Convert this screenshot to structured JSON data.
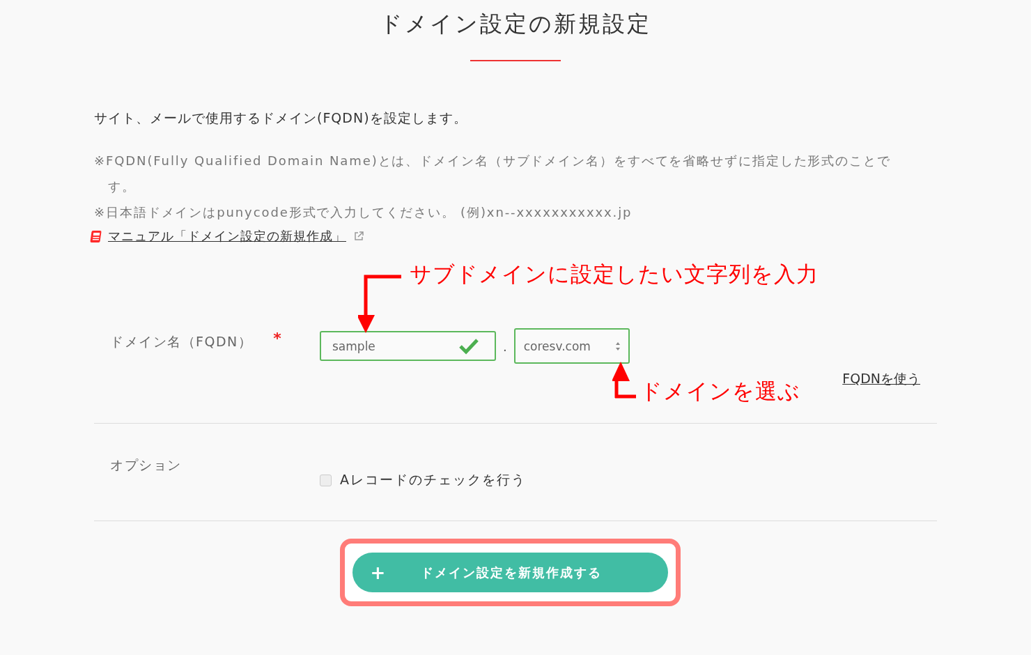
{
  "title": "ドメイン設定の新規設定",
  "description": "サイト、メールで使用するドメイン(FQDN)を設定します。",
  "notes": [
    "※FQDN(Fully Qualified Domain Name)とは、ドメイン名（サブドメイン名）をすべてを省略せずに指定した形式のことです。",
    "※日本語ドメインはpunycode形式で入力してください。 (例)xn--xxxxxxxxxxx.jp"
  ],
  "manual_link": "マニュアル「ドメイン設定の新規作成」",
  "form": {
    "rows": [
      {
        "kind": "domain",
        "label": "ドメイン名（FQDN）",
        "required": true,
        "required_mark": "*",
        "subdomain": {
          "value": "sample",
          "valid": true
        },
        "separator": ".",
        "domain_select": {
          "value": "coresv.com"
        },
        "link": "FQDNを使う"
      },
      {
        "kind": "options",
        "label": "オプション",
        "checkbox": {
          "label": "Aレコードのチェックを行う",
          "checked": false
        }
      }
    ]
  },
  "submit": {
    "icon": "+",
    "label": "ドメイン設定を新規作成する",
    "highlighted": true
  },
  "annotations": [
    {
      "kind": "down",
      "text": "サブドメインに設定したい文字列を入力"
    },
    {
      "kind": "up",
      "text": "ドメインを選ぶ"
    }
  ]
}
